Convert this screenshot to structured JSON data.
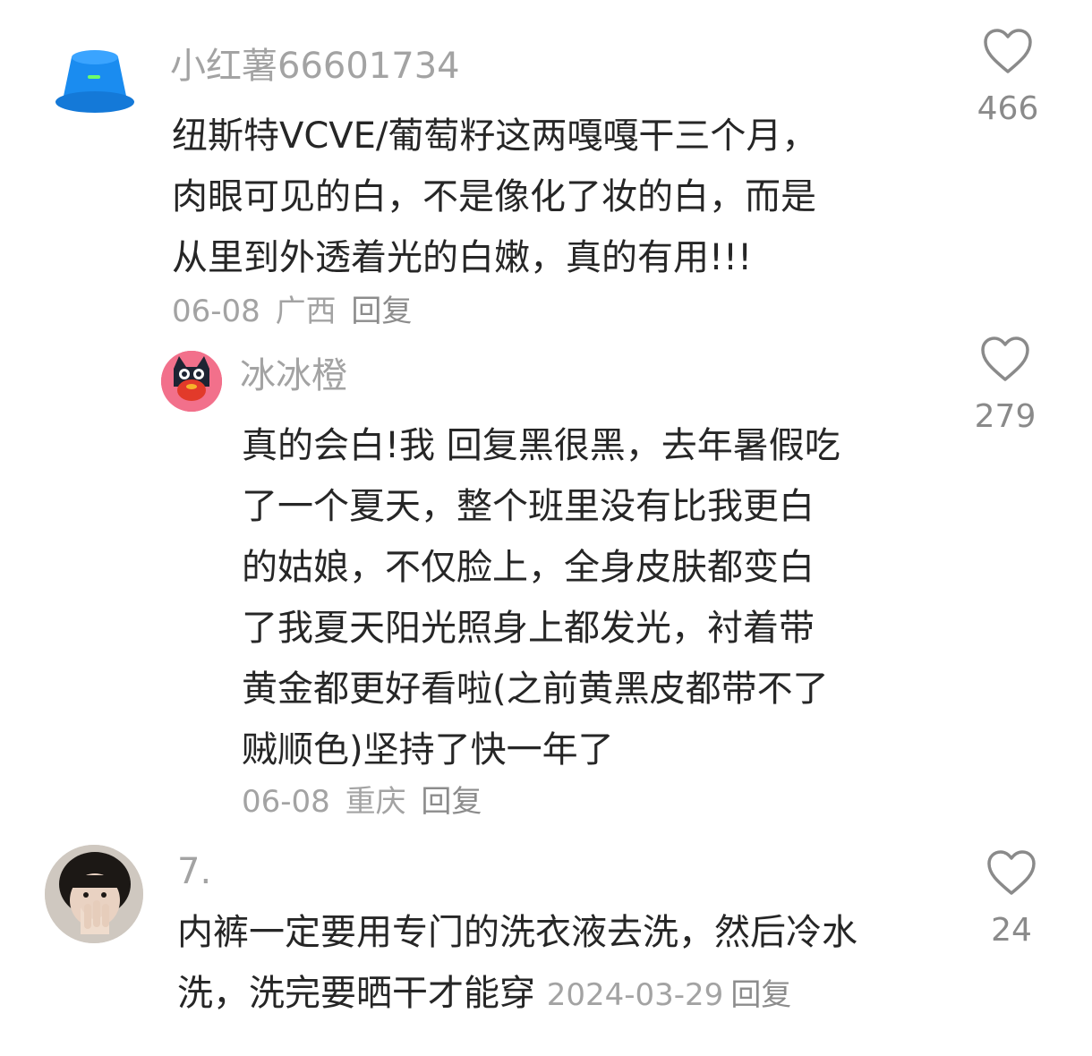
{
  "comments": [
    {
      "username": "小红薯66601734",
      "lines": [
        "纽斯特VCVE/葡萄籽这两嘎嘎干三个月，",
        "肉眼可见的白，不是像化了妆的白，而是",
        "从里到外透着光的白嫩，真的有用!!!"
      ],
      "date": "06-08",
      "location": "广西",
      "reply_label": "回复",
      "likes": "466",
      "avatar": "blue-bucket-hat-avatar"
    },
    {
      "username": "冰冰橙",
      "lines": [
        "真的会白!我 回复黑很黑，去年暑假吃",
        "了一个夏天，整个班里没有比我更白",
        "的姑娘，不仅脸上，全身皮肤都变白",
        "了我夏天阳光照身上都发光，衬着带",
        "黄金都更好看啦(之前黄黑皮都带不了",
        "贼顺色)坚持了快一年了"
      ],
      "date": "06-08",
      "location": "重庆",
      "reply_label": "回复",
      "likes": "279",
      "avatar": "cartoon-cat-avatar"
    },
    {
      "username": "7.",
      "lines": [
        "内裤一定要用专门的洗衣液去洗，然后冷水",
        "洗，洗完要晒干才能穿"
      ],
      "date": "2024-03-29",
      "reply_label": "回复",
      "likes": "24",
      "avatar": "photo-avatar"
    }
  ],
  "colors": {
    "username": "#a3a3a3",
    "text": "#262626",
    "meta": "#a3a3a3",
    "icon": "#8a8a8a"
  }
}
